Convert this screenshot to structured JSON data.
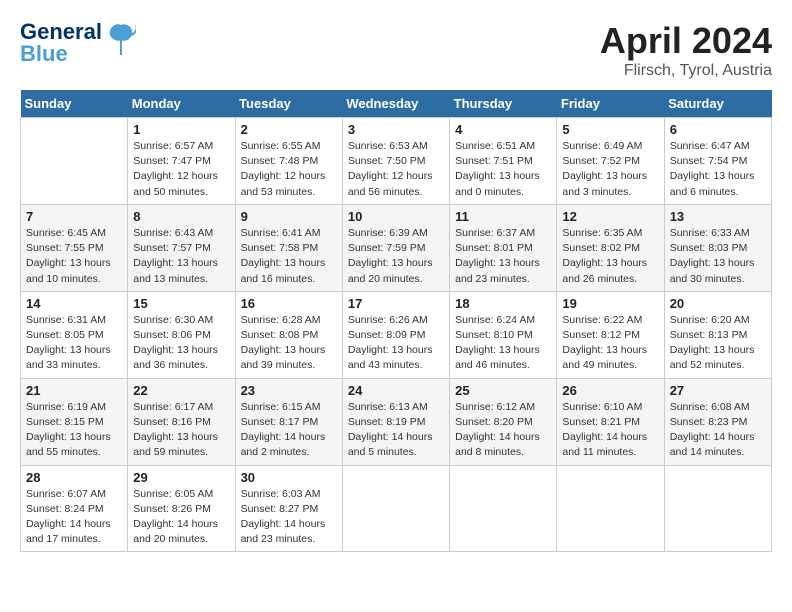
{
  "header": {
    "logo_line1": "General",
    "logo_line2": "Blue",
    "month": "April 2024",
    "location": "Flirsch, Tyrol, Austria"
  },
  "weekdays": [
    "Sunday",
    "Monday",
    "Tuesday",
    "Wednesday",
    "Thursday",
    "Friday",
    "Saturday"
  ],
  "weeks": [
    [
      {
        "day": "",
        "info": ""
      },
      {
        "day": "1",
        "info": "Sunrise: 6:57 AM\nSunset: 7:47 PM\nDaylight: 12 hours\nand 50 minutes."
      },
      {
        "day": "2",
        "info": "Sunrise: 6:55 AM\nSunset: 7:48 PM\nDaylight: 12 hours\nand 53 minutes."
      },
      {
        "day": "3",
        "info": "Sunrise: 6:53 AM\nSunset: 7:50 PM\nDaylight: 12 hours\nand 56 minutes."
      },
      {
        "day": "4",
        "info": "Sunrise: 6:51 AM\nSunset: 7:51 PM\nDaylight: 13 hours\nand 0 minutes."
      },
      {
        "day": "5",
        "info": "Sunrise: 6:49 AM\nSunset: 7:52 PM\nDaylight: 13 hours\nand 3 minutes."
      },
      {
        "day": "6",
        "info": "Sunrise: 6:47 AM\nSunset: 7:54 PM\nDaylight: 13 hours\nand 6 minutes."
      }
    ],
    [
      {
        "day": "7",
        "info": "Sunrise: 6:45 AM\nSunset: 7:55 PM\nDaylight: 13 hours\nand 10 minutes."
      },
      {
        "day": "8",
        "info": "Sunrise: 6:43 AM\nSunset: 7:57 PM\nDaylight: 13 hours\nand 13 minutes."
      },
      {
        "day": "9",
        "info": "Sunrise: 6:41 AM\nSunset: 7:58 PM\nDaylight: 13 hours\nand 16 minutes."
      },
      {
        "day": "10",
        "info": "Sunrise: 6:39 AM\nSunset: 7:59 PM\nDaylight: 13 hours\nand 20 minutes."
      },
      {
        "day": "11",
        "info": "Sunrise: 6:37 AM\nSunset: 8:01 PM\nDaylight: 13 hours\nand 23 minutes."
      },
      {
        "day": "12",
        "info": "Sunrise: 6:35 AM\nSunset: 8:02 PM\nDaylight: 13 hours\nand 26 minutes."
      },
      {
        "day": "13",
        "info": "Sunrise: 6:33 AM\nSunset: 8:03 PM\nDaylight: 13 hours\nand 30 minutes."
      }
    ],
    [
      {
        "day": "14",
        "info": "Sunrise: 6:31 AM\nSunset: 8:05 PM\nDaylight: 13 hours\nand 33 minutes."
      },
      {
        "day": "15",
        "info": "Sunrise: 6:30 AM\nSunset: 8:06 PM\nDaylight: 13 hours\nand 36 minutes."
      },
      {
        "day": "16",
        "info": "Sunrise: 6:28 AM\nSunset: 8:08 PM\nDaylight: 13 hours\nand 39 minutes."
      },
      {
        "day": "17",
        "info": "Sunrise: 6:26 AM\nSunset: 8:09 PM\nDaylight: 13 hours\nand 43 minutes."
      },
      {
        "day": "18",
        "info": "Sunrise: 6:24 AM\nSunset: 8:10 PM\nDaylight: 13 hours\nand 46 minutes."
      },
      {
        "day": "19",
        "info": "Sunrise: 6:22 AM\nSunset: 8:12 PM\nDaylight: 13 hours\nand 49 minutes."
      },
      {
        "day": "20",
        "info": "Sunrise: 6:20 AM\nSunset: 8:13 PM\nDaylight: 13 hours\nand 52 minutes."
      }
    ],
    [
      {
        "day": "21",
        "info": "Sunrise: 6:19 AM\nSunset: 8:15 PM\nDaylight: 13 hours\nand 55 minutes."
      },
      {
        "day": "22",
        "info": "Sunrise: 6:17 AM\nSunset: 8:16 PM\nDaylight: 13 hours\nand 59 minutes."
      },
      {
        "day": "23",
        "info": "Sunrise: 6:15 AM\nSunset: 8:17 PM\nDaylight: 14 hours\nand 2 minutes."
      },
      {
        "day": "24",
        "info": "Sunrise: 6:13 AM\nSunset: 8:19 PM\nDaylight: 14 hours\nand 5 minutes."
      },
      {
        "day": "25",
        "info": "Sunrise: 6:12 AM\nSunset: 8:20 PM\nDaylight: 14 hours\nand 8 minutes."
      },
      {
        "day": "26",
        "info": "Sunrise: 6:10 AM\nSunset: 8:21 PM\nDaylight: 14 hours\nand 11 minutes."
      },
      {
        "day": "27",
        "info": "Sunrise: 6:08 AM\nSunset: 8:23 PM\nDaylight: 14 hours\nand 14 minutes."
      }
    ],
    [
      {
        "day": "28",
        "info": "Sunrise: 6:07 AM\nSunset: 8:24 PM\nDaylight: 14 hours\nand 17 minutes."
      },
      {
        "day": "29",
        "info": "Sunrise: 6:05 AM\nSunset: 8:26 PM\nDaylight: 14 hours\nand 20 minutes."
      },
      {
        "day": "30",
        "info": "Sunrise: 6:03 AM\nSunset: 8:27 PM\nDaylight: 14 hours\nand 23 minutes."
      },
      {
        "day": "",
        "info": ""
      },
      {
        "day": "",
        "info": ""
      },
      {
        "day": "",
        "info": ""
      },
      {
        "day": "",
        "info": ""
      }
    ]
  ]
}
